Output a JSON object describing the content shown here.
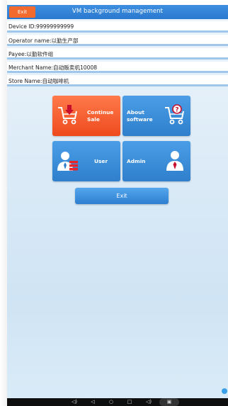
{
  "header": {
    "title": "VM background management",
    "exit_label": "Exit"
  },
  "info": {
    "device_id": "Device ID:99999999999",
    "operator_name": "Operator name:以勤生产部",
    "payee": "Payee:以勤软件组",
    "merchant_name": "Merchant Name:自动贩卖机10008",
    "store_name": "Store Name:自动咖啡机"
  },
  "tiles": {
    "continue_sale": {
      "line1": "Continue",
      "line2": "Sale",
      "color": "#f05a2a"
    },
    "about_software": {
      "line1": "About",
      "line2": "software",
      "color": "#3a8ad8"
    },
    "user": {
      "label": "User",
      "color": "#3a8ad8"
    },
    "admin": {
      "label": "Admin",
      "color": "#3a8ad8"
    }
  },
  "footer": {
    "exit_label": "Exit"
  },
  "icons": {
    "cart_down": "cart-download-icon",
    "cart_help": "cart-question-icon",
    "user": "user-person-icon",
    "admin": "admin-person-icon"
  }
}
